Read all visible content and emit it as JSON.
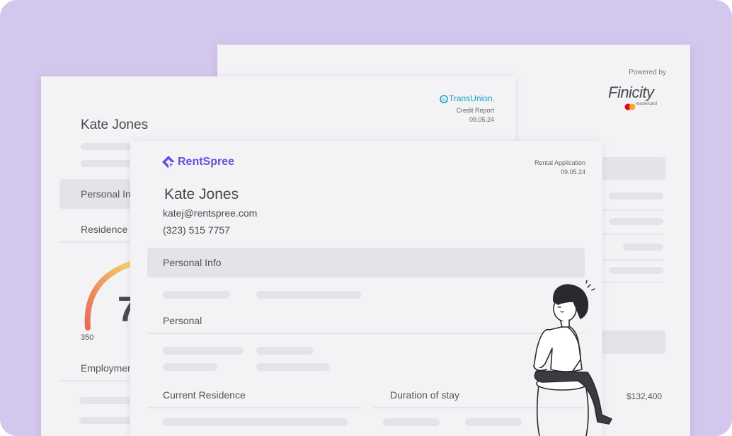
{
  "finicity": {
    "powered_by": "Powered by",
    "brand": "Finicity",
    "sub_brand": "mastercard",
    "amount": "$132,400"
  },
  "transunion": {
    "brand": "TransUnion.",
    "report_type": "Credit Report",
    "date": "09.05.24",
    "name": "Kate Jones",
    "section_personal": "Personal Info",
    "section_residence": "Residence",
    "score_min": "350",
    "score_partial": "7",
    "section_employment": "Employment"
  },
  "rentspree": {
    "brand": "RentSpree",
    "doc_type": "Rental Application",
    "date": "09.05.24",
    "name": "Kate Jones",
    "email": "katej@rentspree.com",
    "phone": "(323) 515 7757",
    "section_personal_info": "Personal Info",
    "section_personal": "Personal",
    "col_current_residence": "Current Residence",
    "col_duration": "Duration of stay"
  },
  "colors": {
    "background": "#d3c7ee",
    "card": "#f3f3f5",
    "rentspree_brand": "#6a4fd8",
    "transunion_brand": "#16a3c4",
    "mastercard_red": "#eb001b",
    "mastercard_orange": "#f79e1b"
  },
  "icons": [
    "rentspree-logo-icon",
    "transunion-logo-icon",
    "mastercard-logo-icon",
    "woman-sitting-illustration"
  ]
}
